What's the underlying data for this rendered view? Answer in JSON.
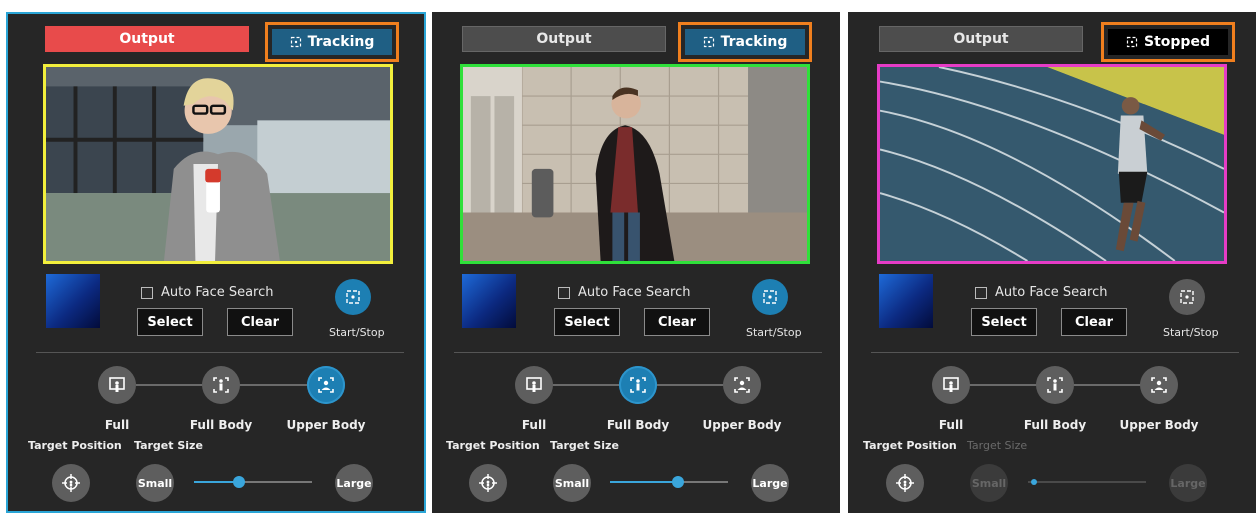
{
  "panels": [
    {
      "output_label": "Output",
      "tracking_label": "Tracking",
      "auto_face_label": "Auto Face Search",
      "select_label": "Select",
      "clear_label": "Clear",
      "startstop_label": "Start/Stop",
      "modes": [
        "Full",
        "Full Body",
        "Upper Body"
      ],
      "active_mode": "Upper Body",
      "target_position_label": "Target Position",
      "target_size_label": "Target Size",
      "small_label": "Small",
      "large_label": "Large",
      "frame_color": "#f2ef3c",
      "size_slider_fraction": 0.38
    },
    {
      "output_label": "Output",
      "tracking_label": "Tracking",
      "auto_face_label": "Auto Face Search",
      "select_label": "Select",
      "clear_label": "Clear",
      "startstop_label": "Start/Stop",
      "modes": [
        "Full",
        "Full Body",
        "Upper Body"
      ],
      "active_mode": "Full Body",
      "target_position_label": "Target Position",
      "target_size_label": "Target Size",
      "small_label": "Small",
      "large_label": "Large",
      "frame_color": "#2fe03a",
      "size_slider_fraction": 0.58
    },
    {
      "output_label": "Output",
      "tracking_label": "Stopped",
      "auto_face_label": "Auto Face Search",
      "select_label": "Select",
      "clear_label": "Clear",
      "startstop_label": "Start/Stop",
      "modes": [
        "Full",
        "Full Body",
        "Upper Body"
      ],
      "active_mode": "",
      "target_position_label": "Target Position",
      "target_size_label": "Target Size",
      "small_label": "Small",
      "large_label": "Large",
      "frame_color": "#e63cc6",
      "size_slider_fraction": 0.05
    }
  ],
  "colors": {
    "output_live": "#e84b4b",
    "accent": "#1d7fb3",
    "highlight_box": "#f07f1e",
    "selected_panel": "#2aa5d6"
  }
}
